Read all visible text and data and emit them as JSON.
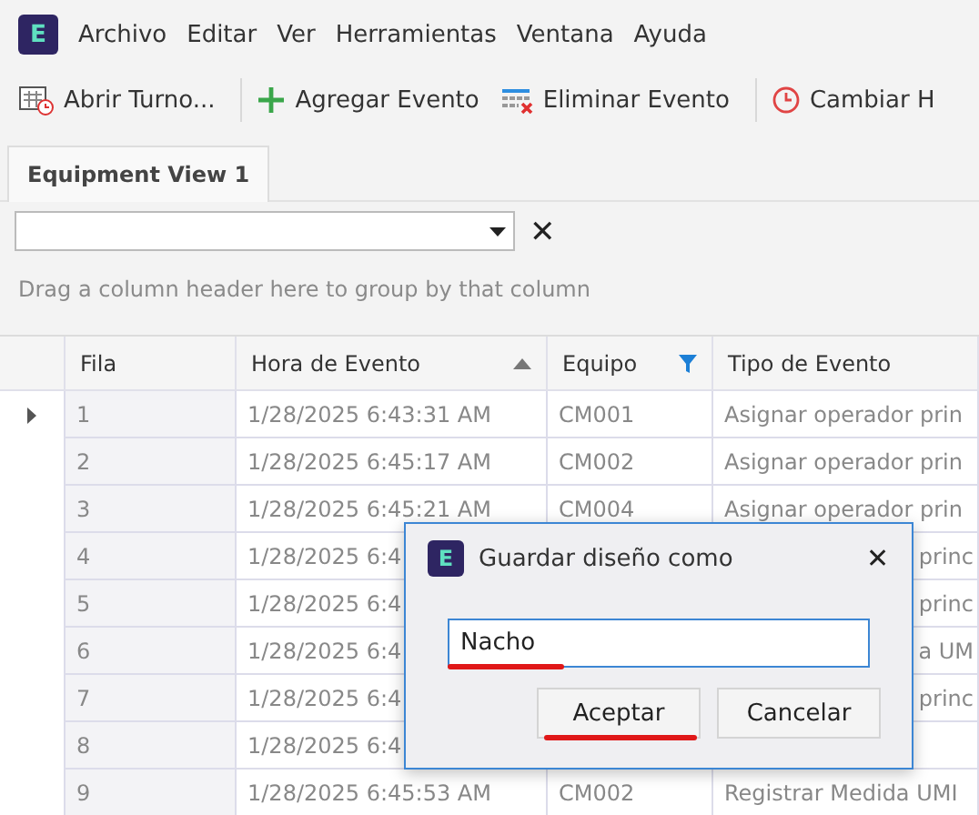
{
  "menu": {
    "logo": "E",
    "items": [
      "Archivo",
      "Editar",
      "Ver",
      "Herramientas",
      "Ventana",
      "Ayuda"
    ]
  },
  "toolbar": [
    {
      "kind": "calendar",
      "label": "Abrir Turno..."
    },
    {
      "kind": "add",
      "label": "Agregar Evento"
    },
    {
      "kind": "delete",
      "label": "Eliminar Evento"
    },
    {
      "kind": "clock",
      "label": "Cambiar H"
    }
  ],
  "tabs": [
    {
      "label": "Equipment View 1",
      "selected": true
    }
  ],
  "filter": {
    "close": "✕"
  },
  "group_panel": "Drag a column header here to group by that column",
  "grid": {
    "columns": [
      {
        "label": "Fila",
        "sorted": false,
        "filtered": false
      },
      {
        "label": "Hora de Evento",
        "sorted": true,
        "filtered": false
      },
      {
        "label": "Equipo",
        "sorted": false,
        "filtered": true
      },
      {
        "label": "Tipo de Evento",
        "sorted": false,
        "filtered": false
      }
    ],
    "rows": [
      {
        "current": true,
        "cells": [
          "1",
          "1/28/2025 6:43:31 AM",
          "CM001",
          "Asignar operador prin"
        ]
      },
      {
        "current": false,
        "cells": [
          "2",
          "1/28/2025 6:45:17 AM",
          "CM002",
          "Asignar operador prin"
        ]
      },
      {
        "current": false,
        "cells": [
          "3",
          "1/28/2025 6:45:21 AM",
          "CM004",
          "Asignar operador prin"
        ]
      },
      {
        "current": false,
        "cells": [
          "4",
          "1/28/2025 6:4",
          "",
          "princ"
        ]
      },
      {
        "current": false,
        "cells": [
          "5",
          "1/28/2025 6:4",
          "",
          "princ"
        ]
      },
      {
        "current": false,
        "cells": [
          "6",
          "1/28/2025 6:4",
          "",
          "a UM"
        ]
      },
      {
        "current": false,
        "cells": [
          "7",
          "1/28/2025 6:4",
          "",
          "princ"
        ]
      },
      {
        "current": false,
        "cells": [
          "8",
          "1/28/2025 6:4",
          "",
          ""
        ]
      },
      {
        "current": false,
        "cells": [
          "9",
          "1/28/2025 6:45:53 AM",
          "CM002",
          "Registrar Medida UMI"
        ]
      }
    ]
  },
  "dialog": {
    "logo": "E",
    "title": "Guardar diseño como",
    "close": "✕",
    "value": "Nacho",
    "buttons": [
      {
        "label": "Aceptar",
        "marked": true
      },
      {
        "label": "Cancelar",
        "marked": false
      }
    ],
    "value_marked": true
  }
}
